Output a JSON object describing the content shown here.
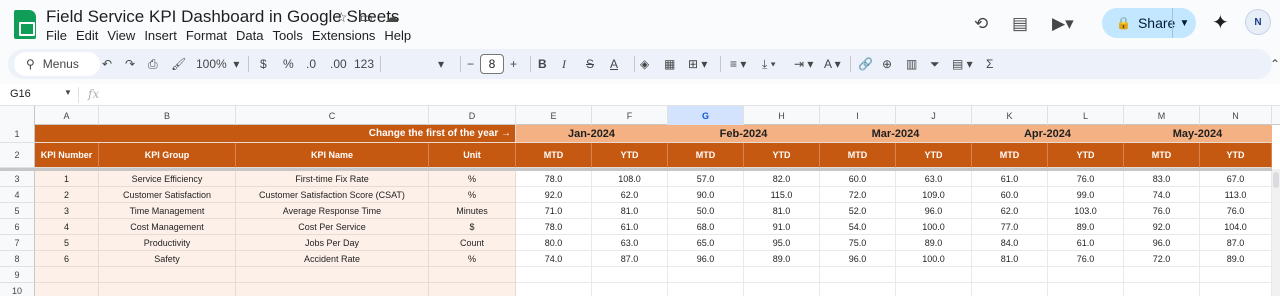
{
  "document": {
    "title": "Field Service KPI Dashboard in Google Sheets"
  },
  "menu": [
    "File",
    "Edit",
    "View",
    "Insert",
    "Format",
    "Data",
    "Tools",
    "Extensions",
    "Help"
  ],
  "share": {
    "label": "Share"
  },
  "avatar": {
    "initials": "N"
  },
  "toolbar": {
    "menus_label": "Menus",
    "zoom": "100%",
    "currency": "$",
    "percent": "%",
    "decrease_decimal": ".0",
    "increase_decimal": ".00",
    "number_format": "123",
    "font_size": "8"
  },
  "formula_bar": {
    "cell_ref": "G16",
    "fx": "fx",
    "content": ""
  },
  "columns": [
    "A",
    "B",
    "C",
    "D",
    "E",
    "F",
    "G",
    "H",
    "I",
    "J",
    "K",
    "L",
    "M",
    "N"
  ],
  "selected_column": "G",
  "rows": [
    "1",
    "2",
    "3",
    "4",
    "5",
    "6",
    "7",
    "8",
    "9",
    "10"
  ],
  "sheet": {
    "banner": "Change the first of the year →",
    "months": [
      "Jan-2024",
      "Feb-2024",
      "Mar-2024",
      "Apr-2024",
      "May-2024"
    ],
    "headers": [
      "KPI Number",
      "KPI Group",
      "KPI Name",
      "Unit",
      "MTD",
      "YTD",
      "MTD",
      "YTD",
      "MTD",
      "YTD",
      "MTD",
      "YTD",
      "MTD",
      "YTD"
    ],
    "data": [
      [
        "1",
        "Service Efficiency",
        "First-time Fix Rate",
        "%",
        "78.0",
        "108.0",
        "57.0",
        "82.0",
        "60.0",
        "63.0",
        "61.0",
        "76.0",
        "83.0",
        "67.0"
      ],
      [
        "2",
        "Customer Satisfaction",
        "Customer Satisfaction Score (CSAT)",
        "%",
        "92.0",
        "62.0",
        "90.0",
        "115.0",
        "72.0",
        "109.0",
        "60.0",
        "99.0",
        "74.0",
        "113.0"
      ],
      [
        "3",
        "Time Management",
        "Average Response Time",
        "Minutes",
        "71.0",
        "81.0",
        "50.0",
        "81.0",
        "52.0",
        "96.0",
        "62.0",
        "103.0",
        "76.0",
        "76.0"
      ],
      [
        "4",
        "Cost Management",
        "Cost Per Service",
        "$",
        "78.0",
        "61.0",
        "68.0",
        "91.0",
        "54.0",
        "100.0",
        "77.0",
        "89.0",
        "92.0",
        "104.0"
      ],
      [
        "5",
        "Productivity",
        "Jobs Per Day",
        "Count",
        "80.0",
        "63.0",
        "65.0",
        "95.0",
        "75.0",
        "89.0",
        "84.0",
        "61.0",
        "96.0",
        "87.0"
      ],
      [
        "6",
        "Safety",
        "Accident Rate",
        "%",
        "74.0",
        "87.0",
        "96.0",
        "89.0",
        "96.0",
        "100.0",
        "81.0",
        "76.0",
        "72.0",
        "89.0"
      ],
      [
        "",
        "",
        "",
        "",
        "",
        "",
        "",
        "",
        "",
        "",
        "",
        "",
        "",
        ""
      ],
      [
        "",
        "",
        "",
        "",
        "",
        "",
        "",
        "",
        "",
        "",
        "",
        "",
        "",
        ""
      ]
    ]
  },
  "colors": {
    "header_dark": "#c65911",
    "header_light": "#f4b183",
    "row_tint": "#fdf0e8",
    "share_bg": "#c2e7ff",
    "selected_col": "#d3e3fd"
  }
}
